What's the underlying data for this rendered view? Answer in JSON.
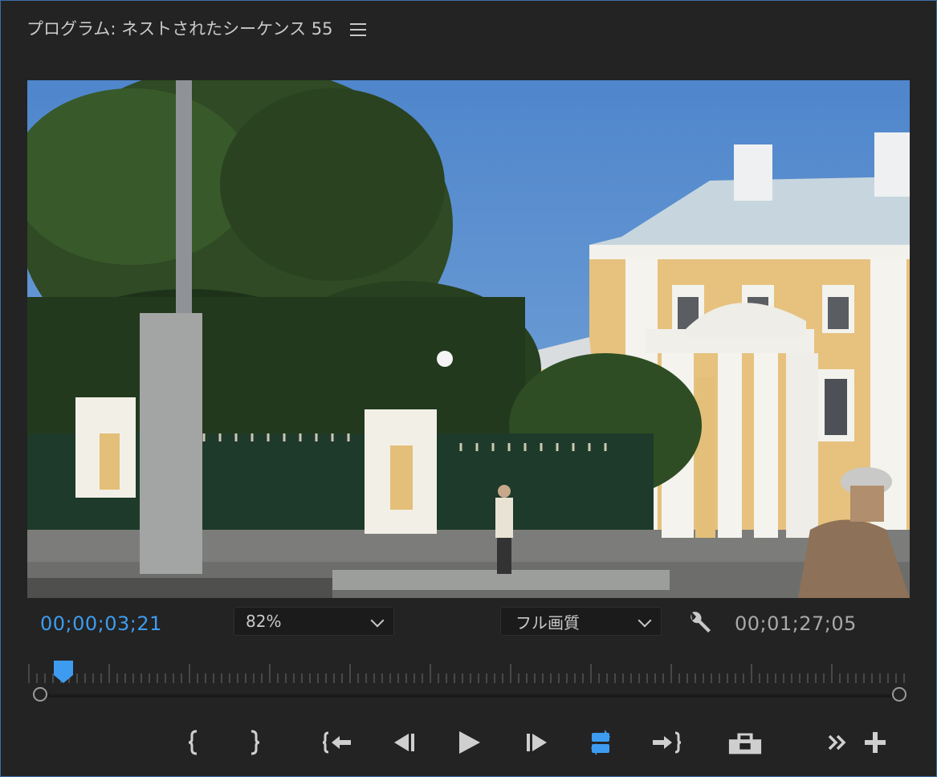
{
  "panel": {
    "title": "プログラム: ネストされたシーケンス 55",
    "menu_icon": "hamburger-menu-icon"
  },
  "viewer": {
    "content": "video-frame"
  },
  "controls": {
    "current_timecode": "00;00;03;21",
    "zoom_value": "82%",
    "quality_value": "フル画質",
    "settings_icon": "wrench-icon",
    "duration_timecode": "00;01;27;05",
    "accent_color": "#3d9cf0"
  },
  "transport": {
    "buttons": [
      {
        "name": "mark-in",
        "icon": "mark-in-icon"
      },
      {
        "name": "mark-out",
        "icon": "mark-out-icon"
      },
      {
        "name": "go-to-in",
        "icon": "go-to-in-icon"
      },
      {
        "name": "step-back",
        "icon": "step-back-icon"
      },
      {
        "name": "play",
        "icon": "play-icon"
      },
      {
        "name": "step-forward",
        "icon": "step-forward-icon"
      },
      {
        "name": "loop",
        "icon": "loop-icon"
      },
      {
        "name": "go-to-out",
        "icon": "go-to-out-icon"
      },
      {
        "name": "export-frame",
        "icon": "camera-icon"
      },
      {
        "name": "more",
        "icon": "double-chevron-icon"
      },
      {
        "name": "add-button",
        "icon": "plus-icon"
      }
    ]
  }
}
